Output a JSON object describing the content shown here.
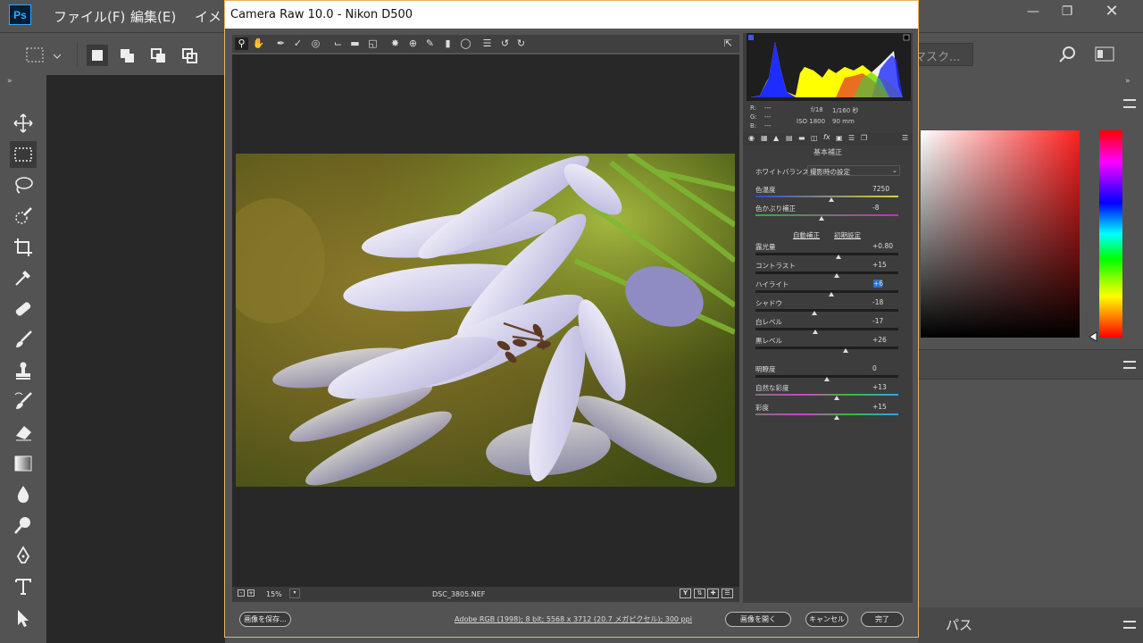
{
  "app": {
    "logo_text": "Ps",
    "menus": [
      "ファイル(F)",
      "編集(E)",
      "イメ"
    ],
    "mask_placeholder": "マスク..."
  },
  "camera_raw": {
    "title": "Camera Raw 10.0  -  Nikon D500",
    "filename": "DSC_3805.NEF",
    "zoom": "15%",
    "camera_info": {
      "r": "R:",
      "g": "G:",
      "b": "B:",
      "dash": "---",
      "aperture": "f/18",
      "shutter": "1/160 秒",
      "iso": "ISO 1800",
      "focal": "90 mm"
    },
    "panel_title": "基本補正",
    "white_balance_label": "ホワイトバランス：",
    "white_balance_value": "撮影時の設定",
    "auto_label": "自動補正",
    "default_label": "初期設定",
    "sliders": [
      {
        "label": "色温度",
        "value": "7250",
        "pos": 0.53
      },
      {
        "label": "色かぶり補正",
        "value": "-8",
        "pos": 0.46
      },
      {
        "label": "露光量",
        "value": "+0.80",
        "pos": 0.58
      },
      {
        "label": "コントラスト",
        "value": "+15",
        "pos": 0.57
      },
      {
        "label": "ハイライト",
        "value": "+6",
        "pos": 0.53
      },
      {
        "label": "シャドウ",
        "value": "-18",
        "pos": 0.41
      },
      {
        "label": "白レベル",
        "value": "-17",
        "pos": 0.42
      },
      {
        "label": "黒レベル",
        "value": "+26",
        "pos": 0.63
      },
      {
        "label": "明瞭度",
        "value": "0",
        "pos": 0.5
      },
      {
        "label": "自然な彩度",
        "value": "+13",
        "pos": 0.57
      },
      {
        "label": "彩度",
        "value": "+15",
        "pos": 0.57
      }
    ],
    "save_label": "画像を保存...",
    "footer_info": "Adobe RGB (1998); 8 bit; 5568 x 3712 (20.7 メガピクセル); 300 ppi",
    "open_label": "画像を開く",
    "cancel_label": "キャンセル",
    "done_label": "完了"
  },
  "right_panel": {
    "tab_label": "パス"
  },
  "colors": {
    "accent_border": "#e8b460",
    "ps_blue": "#31a8ff"
  }
}
